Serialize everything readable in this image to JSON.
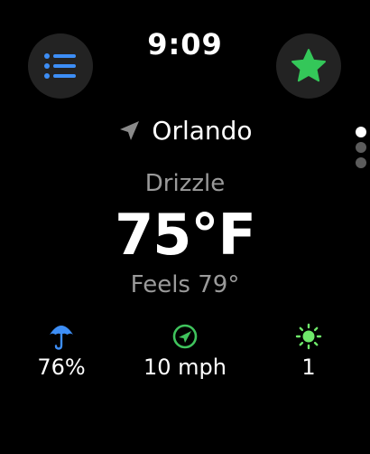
{
  "status": {
    "time": "9:09"
  },
  "location": {
    "name": "Orlando"
  },
  "weather": {
    "condition": "Drizzle",
    "temperature": "75°F",
    "feels_like": "Feels 79°"
  },
  "stats": {
    "precipitation": "76%",
    "wind": "10 mph",
    "uv_index": "1"
  },
  "icons": {
    "menu": "list-icon",
    "favorite": "star-icon",
    "location": "location-arrow-icon",
    "precipitation": "umbrella-icon",
    "wind": "wind-direction-icon",
    "uv": "sun-icon"
  },
  "colors": {
    "accent_blue": "#3d8ef6",
    "star_green": "#34c759",
    "wind_green": "#3fc35c",
    "uv_green": "#6ee86a",
    "muted_text": "#9a9a9a"
  },
  "pager": {
    "count": 3,
    "active_index": 0
  }
}
